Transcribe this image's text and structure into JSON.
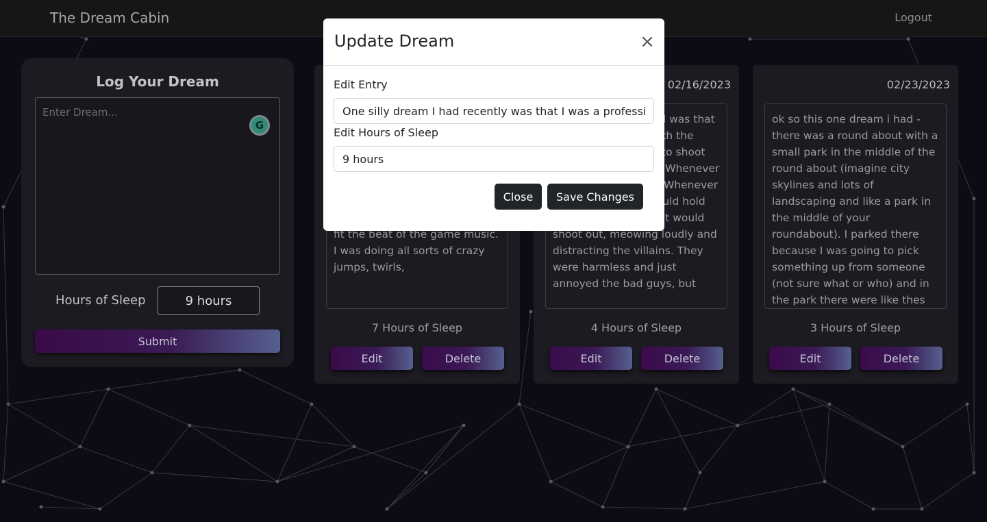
{
  "app": {
    "brand": "The Dream Cabin",
    "logout_label": "Logout"
  },
  "log_form": {
    "title": "Log Your Dream",
    "dream_placeholder": "Enter Dream...",
    "grammarly_icon_letter": "G",
    "hours_label": "Hours of Sleep",
    "hours_value": "9 hours",
    "submit_label": "Submit"
  },
  "cards": [
    {
      "date": "",
      "text": "One silly dream I had recently was that I was a professional dancer. I was on stage and the music started, but it was the theme song from a popular video game. So, I had to improvise my dance moves to fit the beat of the game music. I was doing all sorts of crazy jumps, twirls,",
      "hours": "7 Hours of Sleep",
      "edit_label": "Edit",
      "delete_label": "Delete"
    },
    {
      "date": "02/16/2023",
      "text": "One silly dream I had was that I was a superhero with the power of being able to shoot cats from my hands. Whenever I got in a fight, cats! Whenever I was in trouble, I would hold up my hand and a cat would shoot out, meowing loudly and distracting the villains. They were harmless and just annoyed the bad guys, but",
      "hours": "4 Hours of Sleep",
      "edit_label": "Edit",
      "delete_label": "Delete"
    },
    {
      "date": "02/23/2023",
      "text": "ok so this one dream i had - there was a round about with a small park in the middle of the round about (imagine city skylines and lots of landscaping and like a park in the middle of your roundabout). I parked there because I was going to pick something up from someone (not sure what or who) and in the park there were like thes",
      "hours": "3 Hours of Sleep",
      "edit_label": "Edit",
      "delete_label": "Delete"
    }
  ],
  "modal": {
    "title": "Update Dream",
    "close_icon": "×",
    "entry_label": "Edit Entry",
    "entry_value": "One silly dream I had recently was that I was a professional dancer",
    "hours_label": "Edit Hours of Sleep",
    "hours_value": "9 hours",
    "close_label": "Close",
    "save_label": "Save Changes"
  },
  "colors": {
    "background": "#0e0b15",
    "panel": "#1c1b22",
    "button_gradient_start": "#3b0a4a",
    "button_gradient_end": "#55608e",
    "modal_button": "#212529"
  }
}
